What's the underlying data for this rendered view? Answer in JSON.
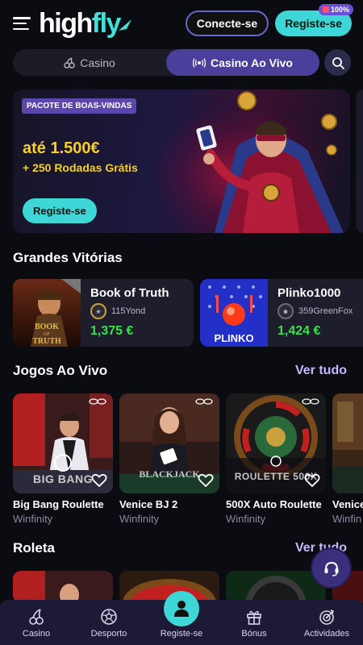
{
  "header": {
    "logo_text_a": "high",
    "logo_text_b": "fly",
    "connect_label": "Conecte-se",
    "register_label": "Registe-se",
    "register_badge": "100%"
  },
  "tabs": [
    {
      "label": "Casino",
      "icon": "cherries-icon",
      "active": false
    },
    {
      "label": "Casino Ao Vivo",
      "icon": "live-broadcast-icon",
      "active": true
    }
  ],
  "banner": {
    "tag": "PACOTE DE BOAS-VINDAS",
    "amount": "até 1.500€",
    "spins": "+ 250 Rodadas Grátis",
    "button": "Registe-se"
  },
  "big_wins": {
    "title": "Grandes Vitórias",
    "items": [
      {
        "game": "Book of Truth",
        "user": "115Yond",
        "amount": "1,375 €"
      },
      {
        "game": "Plinko1000",
        "user": "359GreenFox",
        "amount": "1,424 €"
      }
    ]
  },
  "live_games": {
    "title": "Jogos Ao Vivo",
    "see_all": "Ver tudo",
    "items": [
      {
        "name": "Big Bang Roulette",
        "provider": "Winfinity",
        "art": "BIG BANG"
      },
      {
        "name": "Venice BJ 2",
        "provider": "Winfinity",
        "art": "BLACKJACK"
      },
      {
        "name": "500X Auto Roulette",
        "provider": "Winfinity",
        "art": "ROULETTE 500X"
      },
      {
        "name": "Venice",
        "provider": "Winfin",
        "art": ""
      }
    ]
  },
  "roulette": {
    "title": "Roleta",
    "see_all": "Ver tudo"
  },
  "bottom_nav": [
    {
      "label": "Casino",
      "icon": "cherries-icon"
    },
    {
      "label": "Desporto",
      "icon": "soccer-ball-icon"
    },
    {
      "label": "Registe-se",
      "icon": "user-icon"
    },
    {
      "label": "Bónus",
      "icon": "gift-icon"
    },
    {
      "label": "Actividades",
      "icon": "target-icon"
    }
  ],
  "colors": {
    "accent_cyan": "#3ed6d6",
    "accent_purple": "#4a3f9a",
    "win_green": "#38e04a",
    "banner_yellow": "#f7cf2a"
  }
}
